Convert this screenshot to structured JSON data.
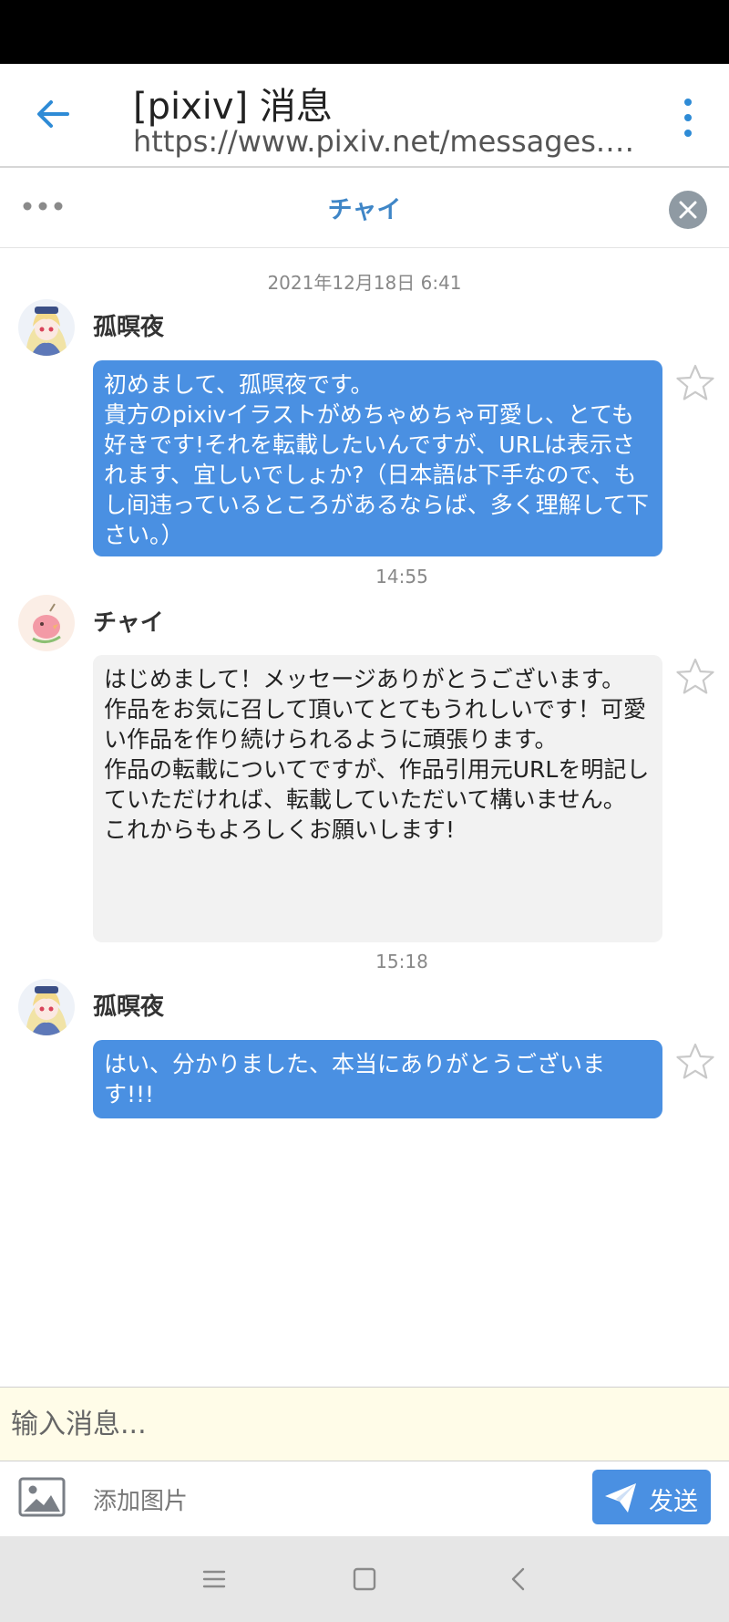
{
  "app_bar": {
    "title": "[pixiv] 消息",
    "url": "https://www.pixiv.net/messages.php",
    "back_icon": "arrow-left-icon",
    "menu_icon": "more-vertical-icon"
  },
  "chat_header": {
    "name": "チャイ",
    "menu_icon": "more-horizontal-icon",
    "close_icon": "close-circle-icon"
  },
  "conversation": {
    "date": "2021年12月18日 6:41",
    "messages": [
      {
        "sender": "孤暝夜",
        "text": "初めまして、孤暝夜です。\n貴方のpixivイラストがめちゃめちゃ可愛し、とても好きです!それを転載したいんですが、URLは表示されます、宜しいでしょか?（日本語は下手なので、もし间违っているところがあるならば、多く理解して下さい。）",
        "time": "14:55",
        "mine": true
      },
      {
        "sender": "チャイ",
        "text": "はじめまして！メッセージありがとうございます。\n作品をお気に召して頂いてとてもうれしいです！可愛い作品を作り続けられるように頑張ります。\n作品の転載についてですが、作品引用元URLを明記していただければ、転載していただいて構いません。\nこれからもよろしくお願いします!",
        "time": "15:18",
        "mine": false
      },
      {
        "sender": "孤暝夜",
        "text": "はい、分かりました、本当にありがとうございます!!!",
        "mine": true
      }
    ]
  },
  "composer": {
    "placeholder": "输入消息...",
    "add_image_label": "添加图片",
    "send_label": "发送",
    "image_icon": "image-icon",
    "send_icon": "paper-plane-icon"
  },
  "colors": {
    "accent": "#4a90e2",
    "header_name": "#3f86c7",
    "incoming_bubble": "#f2f2f2",
    "input_background": "#fffce8"
  }
}
